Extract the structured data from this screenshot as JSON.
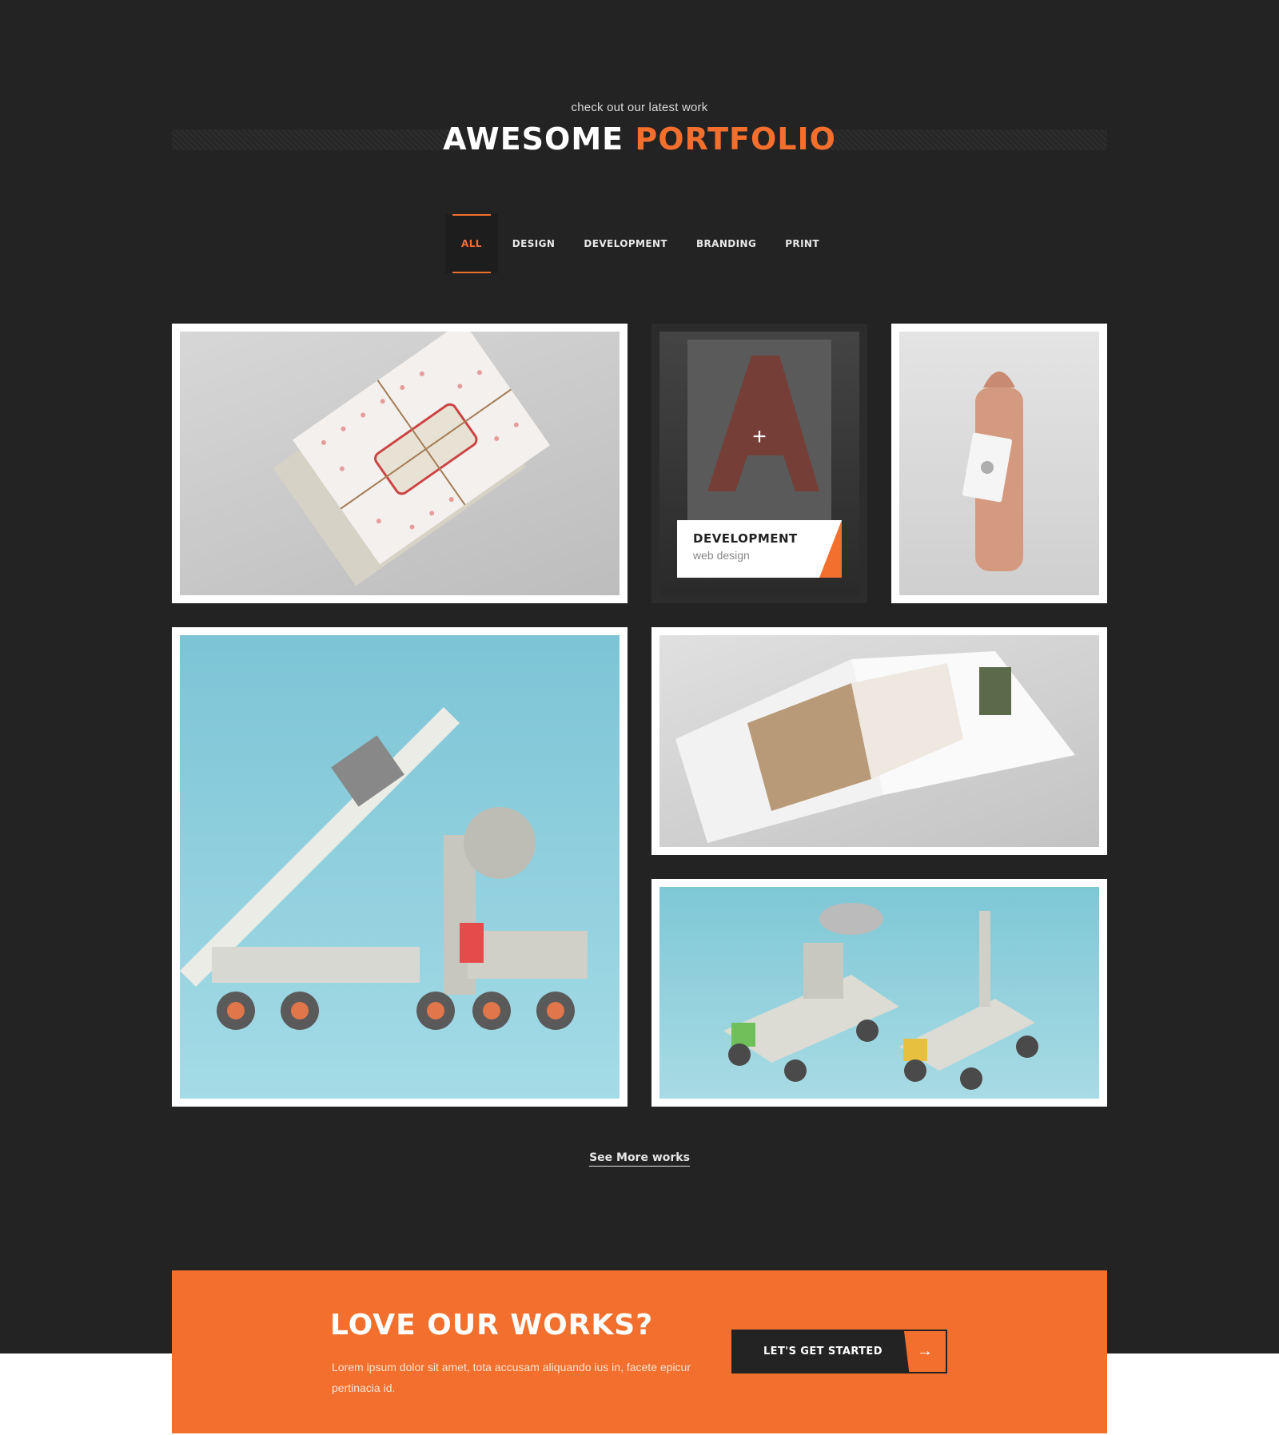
{
  "header": {
    "eyebrow": "check out our latest work",
    "title_main": "AWESOME",
    "title_accent": "PORTFOLIO"
  },
  "filters": [
    {
      "label": "ALL",
      "active": true
    },
    {
      "label": "DESIGN",
      "active": false
    },
    {
      "label": "DEVELOPMENT",
      "active": false
    },
    {
      "label": "BRANDING",
      "active": false
    },
    {
      "label": "PRINT",
      "active": false
    }
  ],
  "portfolio": {
    "items": [
      {
        "image": "invitation-mockup"
      },
      {
        "image": "a3-poster",
        "category": "DEVELOPMENT",
        "subtitle": "web design",
        "hover": true
      },
      {
        "image": "coffee-bag-tag"
      },
      {
        "image": "toy-rocket-vehicles"
      },
      {
        "image": "open-magazine"
      },
      {
        "image": "toy-rover-vehicles"
      }
    ],
    "see_more": "See More works"
  },
  "cta": {
    "title": "LOVE OUR WORKS?",
    "text": "Lorem ipsum dolor sit amet, tota accusam aliquando ius in, facete epicur pertinacia id.",
    "button_label": "LET'S GET STARTED",
    "button_icon": "arrow-right-icon"
  },
  "colors": {
    "accent": "#f26f2d",
    "dark_bg": "#232323",
    "white": "#ffffff"
  }
}
